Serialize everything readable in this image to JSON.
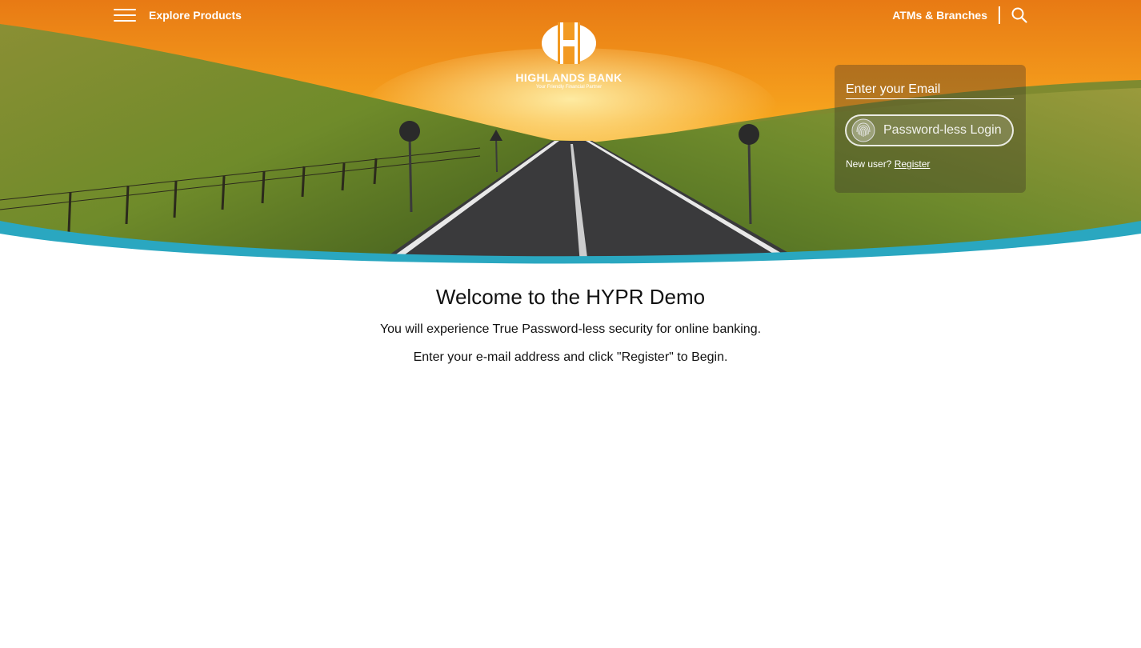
{
  "nav": {
    "explore_label": "Explore Products",
    "atms_label": "ATMs & Branches"
  },
  "logo": {
    "name": "HIGHLANDS BANK",
    "tagline": "Your Friendly Financial Partner"
  },
  "login": {
    "email_placeholder": "Enter your Email",
    "button_label": "Password-less Login",
    "new_user_text": "New user?",
    "register_link": "Register"
  },
  "welcome": {
    "title": "Welcome to the HYPR Demo",
    "line1": "You will experience True Password-less security for online banking.",
    "line2": "Enter your e-mail address and click \"Register\" to Begin."
  },
  "colors": {
    "accent_wave": "#2aa7c0",
    "sky": "#f08a1c",
    "grass": "#6d8f2e"
  },
  "icons": [
    "menu-icon",
    "search-icon",
    "fingerprint-icon",
    "bank-logo-icon"
  ]
}
